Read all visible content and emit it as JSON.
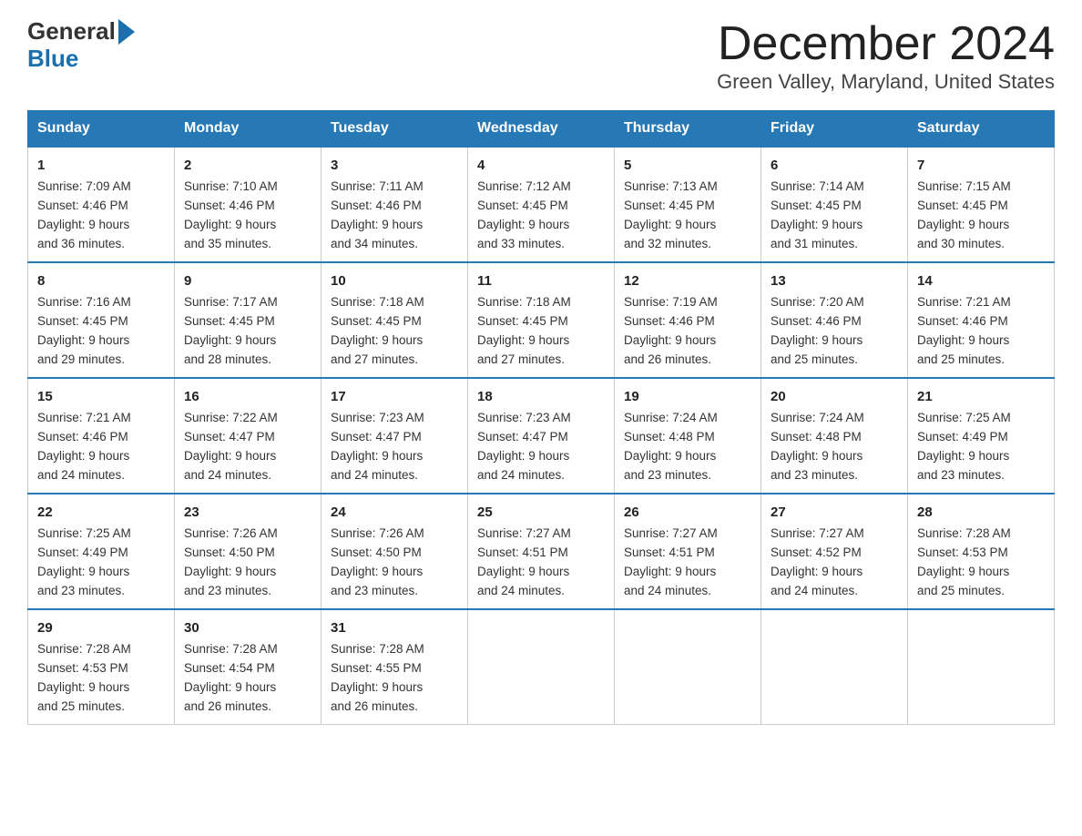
{
  "logo": {
    "line1": "General",
    "line2": "Blue"
  },
  "title": {
    "month_year": "December 2024",
    "location": "Green Valley, Maryland, United States"
  },
  "days_of_week": [
    "Sunday",
    "Monday",
    "Tuesday",
    "Wednesday",
    "Thursday",
    "Friday",
    "Saturday"
  ],
  "weeks": [
    [
      {
        "date": "1",
        "sunrise": "7:09 AM",
        "sunset": "4:46 PM",
        "daylight": "9 hours and 36 minutes."
      },
      {
        "date": "2",
        "sunrise": "7:10 AM",
        "sunset": "4:46 PM",
        "daylight": "9 hours and 35 minutes."
      },
      {
        "date": "3",
        "sunrise": "7:11 AM",
        "sunset": "4:46 PM",
        "daylight": "9 hours and 34 minutes."
      },
      {
        "date": "4",
        "sunrise": "7:12 AM",
        "sunset": "4:45 PM",
        "daylight": "9 hours and 33 minutes."
      },
      {
        "date": "5",
        "sunrise": "7:13 AM",
        "sunset": "4:45 PM",
        "daylight": "9 hours and 32 minutes."
      },
      {
        "date": "6",
        "sunrise": "7:14 AM",
        "sunset": "4:45 PM",
        "daylight": "9 hours and 31 minutes."
      },
      {
        "date": "7",
        "sunrise": "7:15 AM",
        "sunset": "4:45 PM",
        "daylight": "9 hours and 30 minutes."
      }
    ],
    [
      {
        "date": "8",
        "sunrise": "7:16 AM",
        "sunset": "4:45 PM",
        "daylight": "9 hours and 29 minutes."
      },
      {
        "date": "9",
        "sunrise": "7:17 AM",
        "sunset": "4:45 PM",
        "daylight": "9 hours and 28 minutes."
      },
      {
        "date": "10",
        "sunrise": "7:18 AM",
        "sunset": "4:45 PM",
        "daylight": "9 hours and 27 minutes."
      },
      {
        "date": "11",
        "sunrise": "7:18 AM",
        "sunset": "4:45 PM",
        "daylight": "9 hours and 27 minutes."
      },
      {
        "date": "12",
        "sunrise": "7:19 AM",
        "sunset": "4:46 PM",
        "daylight": "9 hours and 26 minutes."
      },
      {
        "date": "13",
        "sunrise": "7:20 AM",
        "sunset": "4:46 PM",
        "daylight": "9 hours and 25 minutes."
      },
      {
        "date": "14",
        "sunrise": "7:21 AM",
        "sunset": "4:46 PM",
        "daylight": "9 hours and 25 minutes."
      }
    ],
    [
      {
        "date": "15",
        "sunrise": "7:21 AM",
        "sunset": "4:46 PM",
        "daylight": "9 hours and 24 minutes."
      },
      {
        "date": "16",
        "sunrise": "7:22 AM",
        "sunset": "4:47 PM",
        "daylight": "9 hours and 24 minutes."
      },
      {
        "date": "17",
        "sunrise": "7:23 AM",
        "sunset": "4:47 PM",
        "daylight": "9 hours and 24 minutes."
      },
      {
        "date": "18",
        "sunrise": "7:23 AM",
        "sunset": "4:47 PM",
        "daylight": "9 hours and 24 minutes."
      },
      {
        "date": "19",
        "sunrise": "7:24 AM",
        "sunset": "4:48 PM",
        "daylight": "9 hours and 23 minutes."
      },
      {
        "date": "20",
        "sunrise": "7:24 AM",
        "sunset": "4:48 PM",
        "daylight": "9 hours and 23 minutes."
      },
      {
        "date": "21",
        "sunrise": "7:25 AM",
        "sunset": "4:49 PM",
        "daylight": "9 hours and 23 minutes."
      }
    ],
    [
      {
        "date": "22",
        "sunrise": "7:25 AM",
        "sunset": "4:49 PM",
        "daylight": "9 hours and 23 minutes."
      },
      {
        "date": "23",
        "sunrise": "7:26 AM",
        "sunset": "4:50 PM",
        "daylight": "9 hours and 23 minutes."
      },
      {
        "date": "24",
        "sunrise": "7:26 AM",
        "sunset": "4:50 PM",
        "daylight": "9 hours and 23 minutes."
      },
      {
        "date": "25",
        "sunrise": "7:27 AM",
        "sunset": "4:51 PM",
        "daylight": "9 hours and 24 minutes."
      },
      {
        "date": "26",
        "sunrise": "7:27 AM",
        "sunset": "4:51 PM",
        "daylight": "9 hours and 24 minutes."
      },
      {
        "date": "27",
        "sunrise": "7:27 AM",
        "sunset": "4:52 PM",
        "daylight": "9 hours and 24 minutes."
      },
      {
        "date": "28",
        "sunrise": "7:28 AM",
        "sunset": "4:53 PM",
        "daylight": "9 hours and 25 minutes."
      }
    ],
    [
      {
        "date": "29",
        "sunrise": "7:28 AM",
        "sunset": "4:53 PM",
        "daylight": "9 hours and 25 minutes."
      },
      {
        "date": "30",
        "sunrise": "7:28 AM",
        "sunset": "4:54 PM",
        "daylight": "9 hours and 26 minutes."
      },
      {
        "date": "31",
        "sunrise": "7:28 AM",
        "sunset": "4:55 PM",
        "daylight": "9 hours and 26 minutes."
      },
      null,
      null,
      null,
      null
    ]
  ],
  "labels": {
    "sunrise": "Sunrise:",
    "sunset": "Sunset:",
    "daylight": "Daylight:"
  }
}
